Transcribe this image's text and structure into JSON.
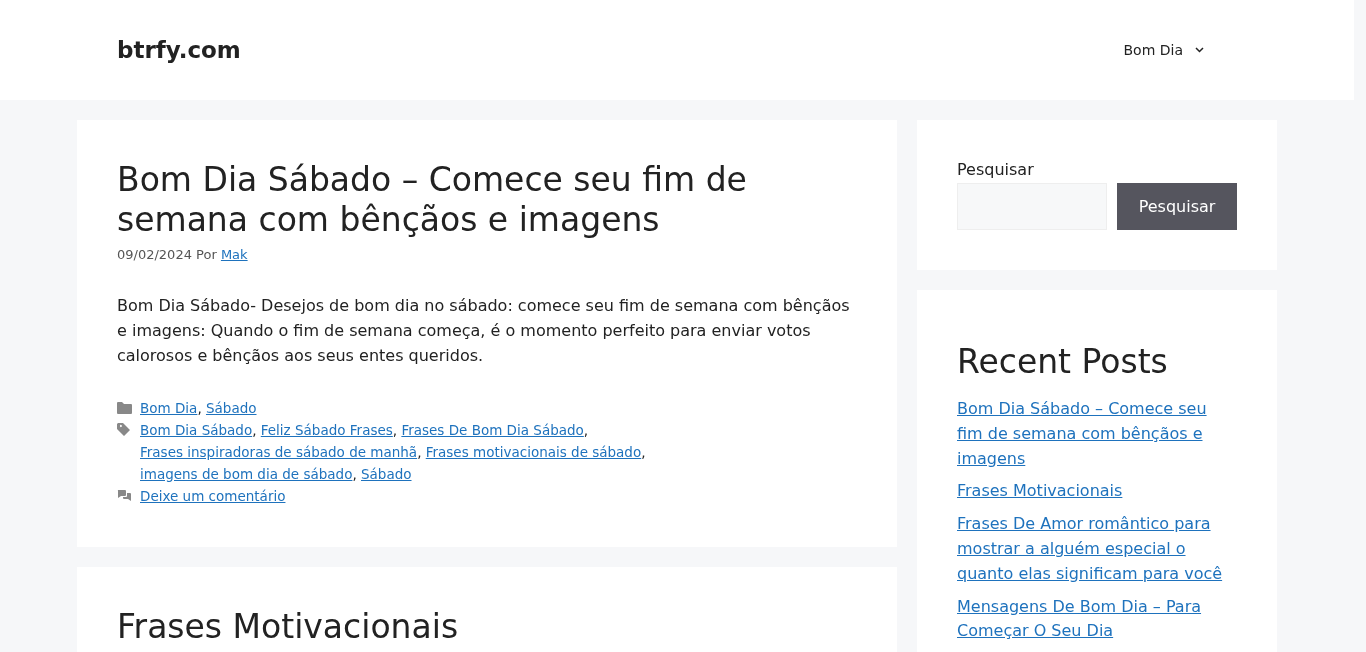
{
  "site": {
    "title": "btrfy.com"
  },
  "nav": [
    {
      "label": "Bom Dia",
      "has_dropdown": true
    }
  ],
  "posts": [
    {
      "title": "Bom Dia Sábado – Comece seu fim de semana com bênçãos e imagens",
      "date": "09/02/2024",
      "by_label": "Por",
      "author": "Mak",
      "excerpt": "Bom Dia Sábado- Desejos de bom dia no sábado: comece seu fim de semana com bênçãos e imagens: Quando o fim de semana começa, é o momento perfeito para enviar votos calorosos e bênçãos aos seus entes queridos.",
      "separator": ",",
      "categories": [
        "Bom Dia",
        "Sábado"
      ],
      "tags": [
        "Bom Dia Sábado",
        "Feliz Sábado Frases",
        "Frases De Bom Dia Sábado",
        "Frases inspiradoras de sábado de manhã",
        "Frases motivacionais de sábado",
        "imagens de bom dia de sábado",
        "Sábado"
      ],
      "comments_link": "Deixe um comentário"
    },
    {
      "title": "Frases Motivacionais"
    }
  ],
  "sidebar": {
    "search": {
      "label": "Pesquisar",
      "button": "Pesquisar"
    },
    "recent_posts": {
      "title": "Recent Posts",
      "links": [
        "Bom Dia Sábado – Comece seu fim de semana com bênçãos e imagens",
        "Frases Motivacionais",
        "Frases De Amor romântico para mostrar a alguém especial o quanto elas significam para você",
        "Mensagens De Bom Dia – Para Começar O Seu Dia"
      ]
    }
  }
}
